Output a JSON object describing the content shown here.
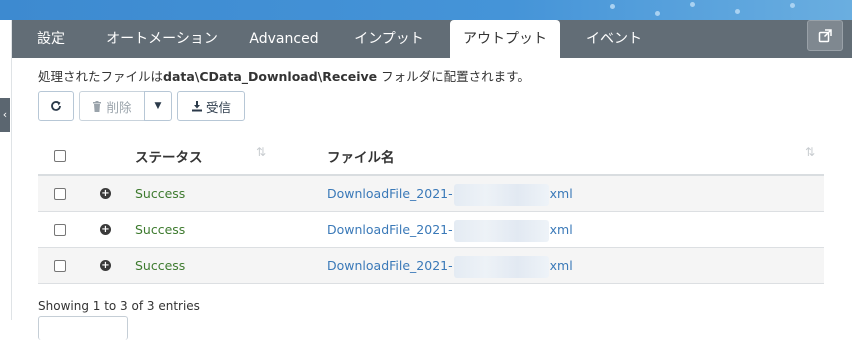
{
  "tabs": [
    {
      "label": "設定",
      "active": false
    },
    {
      "label": "オートメーション",
      "active": false
    },
    {
      "label": "Advanced",
      "active": false
    },
    {
      "label": "インプット",
      "active": false
    },
    {
      "label": "アウトプット",
      "active": true
    },
    {
      "label": "イベント",
      "active": false
    }
  ],
  "note": {
    "prefix": "処理されたファイルは",
    "path": "data\\CData_Download\\Receive",
    "suffix": " フォルダに配置されます。"
  },
  "toolbar": {
    "refresh_icon": "refresh-icon",
    "delete_label": "削除",
    "delete_icon": "trash-icon",
    "dropdown_icon": "caret-down-icon",
    "receive_label": "受信",
    "receive_icon": "download-icon"
  },
  "table": {
    "headers": {
      "status": "ステータス",
      "filename": "ファイル名"
    },
    "rows": [
      {
        "status": "Success",
        "filename_prefix": "DownloadFile_2021-",
        "filename_suffix": "xml"
      },
      {
        "status": "Success",
        "filename_prefix": "DownloadFile_2021-",
        "filename_suffix": "xml"
      },
      {
        "status": "Success",
        "filename_prefix": "DownloadFile_2021-",
        "filename_suffix": "xml"
      }
    ]
  },
  "footer": {
    "entries": "Showing 1 to 3 of 3 entries"
  },
  "colors": {
    "tabbar": "#626d76",
    "accent_blue": "#3a79b8",
    "success_green": "#3d7a2e",
    "top_strip": "#3f8fd2"
  }
}
